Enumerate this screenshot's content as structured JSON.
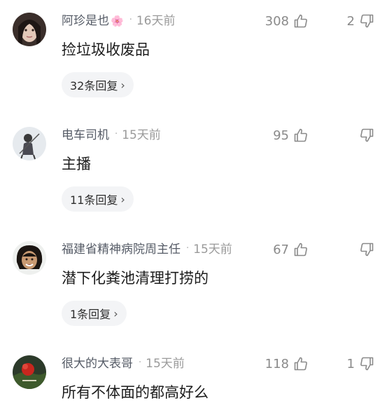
{
  "comments": [
    {
      "user": "阿珍是也",
      "time": "16天前",
      "likes": "308",
      "dislikes": "2",
      "text": "捡垃圾收废品",
      "replies": "32条回复"
    },
    {
      "user": "电车司机",
      "time": "15天前",
      "likes": "95",
      "dislikes": "",
      "text": "主播",
      "replies": "11条回复"
    },
    {
      "user": "福建省精神病院周主任",
      "time": "15天前",
      "likes": "67",
      "dislikes": "",
      "text": "潜下化粪池清理打捞的",
      "replies": "1条回复"
    },
    {
      "user": "很大的大表哥",
      "time": "15天前",
      "likes": "118",
      "dislikes": "1",
      "text": "所有不体面的都高好么",
      "replies": ""
    }
  ],
  "icons": {
    "like": "thumbs-up-outline",
    "dislike": "thumbs-down-outline",
    "reply_chevron": "chevron-right",
    "user_flower": "cherry-blossom"
  },
  "glyphs": {
    "separator": "·",
    "chevron": "›",
    "flower": "🌸"
  }
}
